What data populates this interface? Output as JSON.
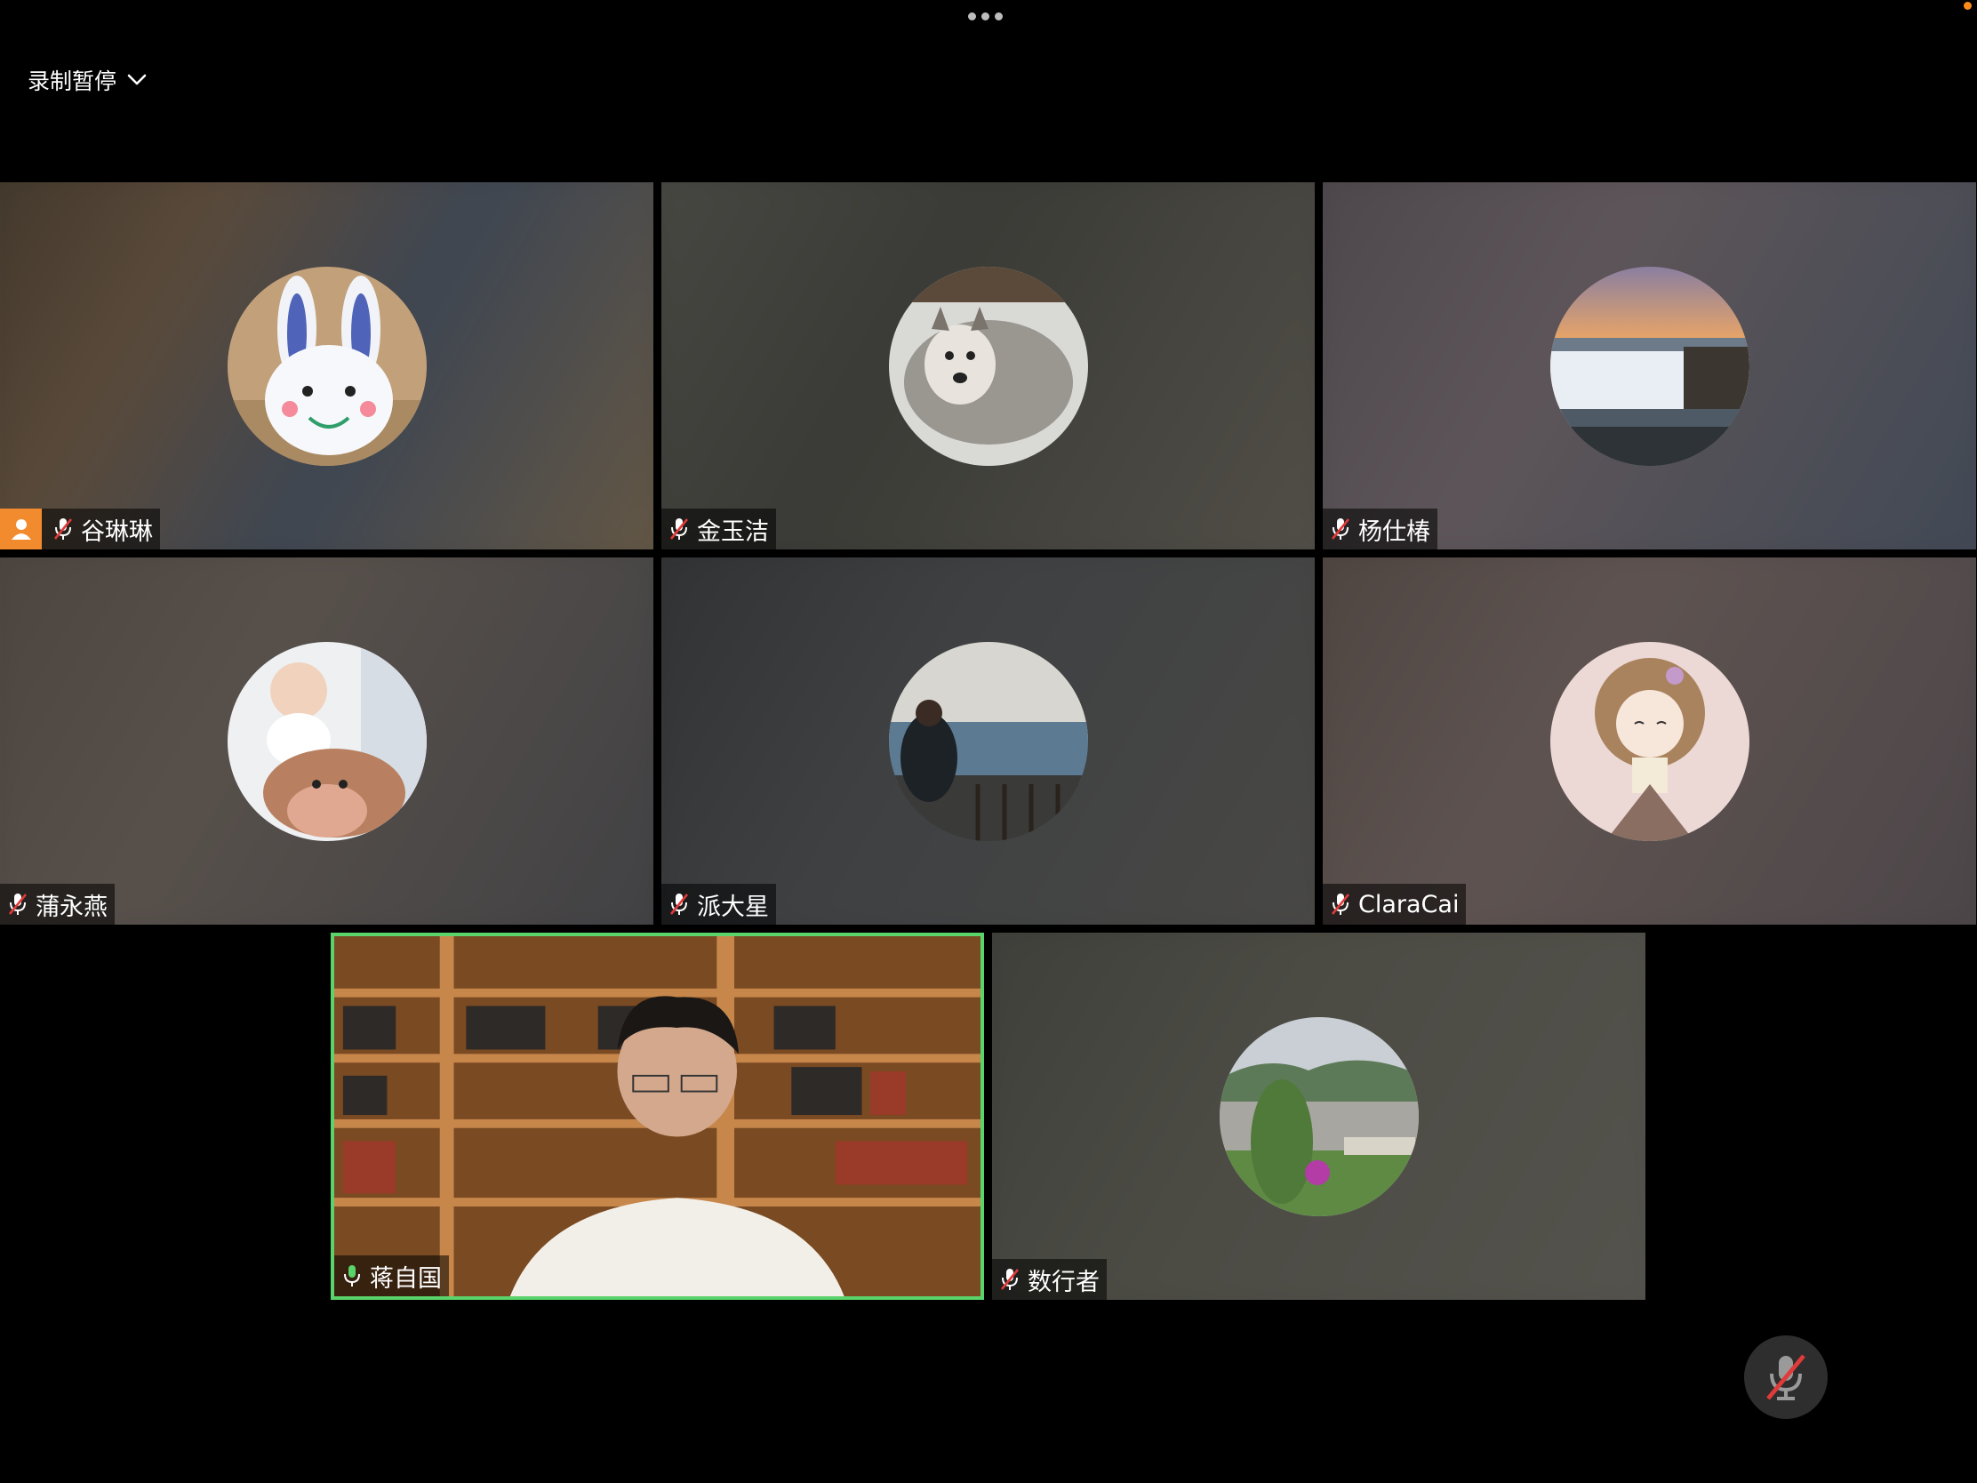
{
  "topbar": {
    "recording_label": "录制暂停",
    "more_icon": "more-dots-icon",
    "chevron_icon": "chevron-down-icon"
  },
  "colors": {
    "host_badge": "#f28a2e",
    "active_speaker_border": "#5ad36a",
    "muted_mic": "#e03a3a"
  },
  "participants": [
    {
      "name": "谷琳琳",
      "host": true,
      "muted": true,
      "avatar": "bunny-avatar"
    },
    {
      "name": "金玉洁",
      "host": false,
      "muted": true,
      "avatar": "dog-avatar"
    },
    {
      "name": "杨仕椿",
      "host": false,
      "muted": true,
      "avatar": "waterfall-avatar"
    },
    {
      "name": "蒲永燕",
      "host": false,
      "muted": true,
      "avatar": "baby-avatar"
    },
    {
      "name": "派大星",
      "host": false,
      "muted": true,
      "avatar": "seaside-avatar"
    },
    {
      "name": "ClaraCai",
      "host": false,
      "muted": true,
      "avatar": "cartoon-girl-avatar"
    },
    {
      "name": "蒋自国",
      "host": false,
      "muted": false,
      "speaking": true,
      "avatar": "camera-video"
    },
    {
      "name": "数行者",
      "host": false,
      "muted": true,
      "avatar": "landscape-avatar"
    }
  ],
  "controls": {
    "mute_button_icon": "mic-muted-icon"
  }
}
